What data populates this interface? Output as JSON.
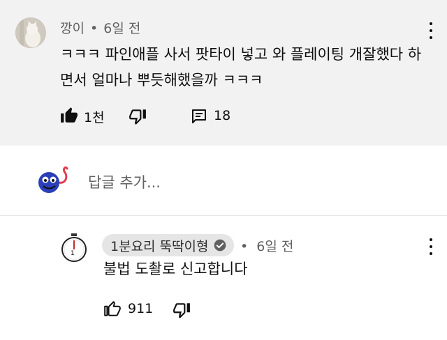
{
  "top_comment": {
    "author": "깡이",
    "separator": "•",
    "time": "6일 전",
    "text": "ㅋㅋㅋ 파인애플 사서 팟타이 넣고 와 플레이팅 개잘했다 하면서 얼마나 뿌듯해했을까 ㅋㅋㅋ",
    "like_count": "1천",
    "reply_count": "18"
  },
  "add_comment": {
    "placeholder": "답글 추가..."
  },
  "reply": {
    "author": "1분요리 뚝딱이형",
    "separator": "•",
    "time": "6일 전",
    "text": "불법 도촬로 신고합니다",
    "like_count": "911"
  },
  "colors": {
    "comment_background": "#f2f2f2",
    "author_badge": "#e5e5e5",
    "text_primary": "#0f0f0f",
    "text_secondary": "#606060"
  },
  "icons": [
    "more-vert-icon",
    "thumb-up-icon",
    "thumb-down-icon",
    "comment-icon",
    "verified-check-icon"
  ]
}
